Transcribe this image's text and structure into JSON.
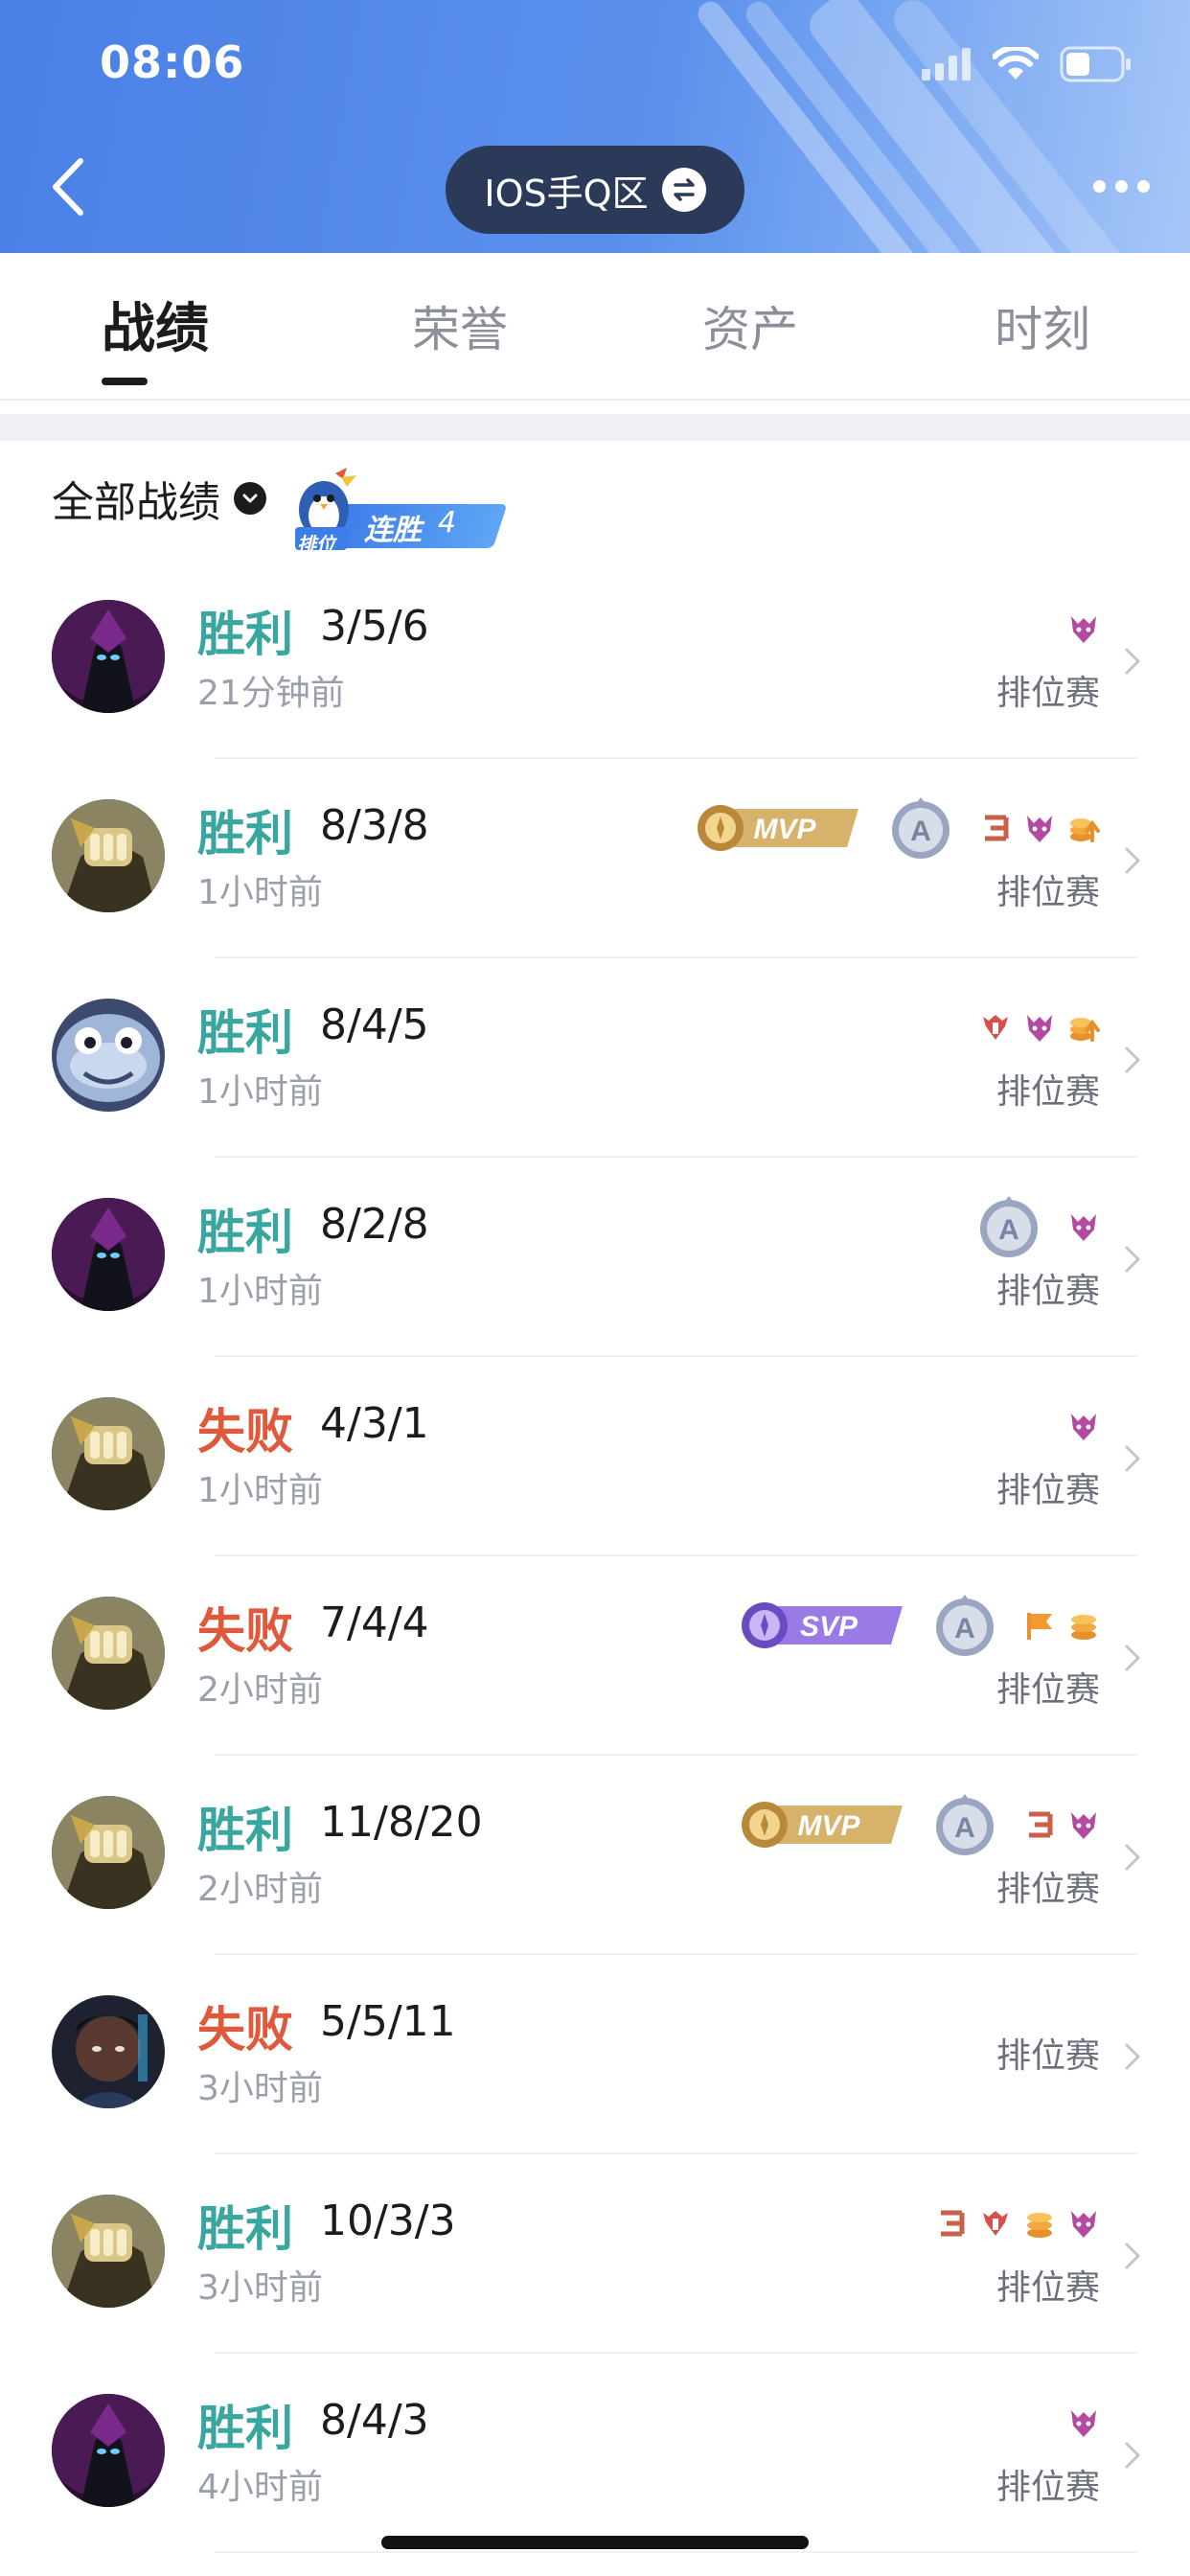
{
  "status_bar": {
    "time": "08:06"
  },
  "header": {
    "region_label": "IOS手Q区"
  },
  "tabs": [
    {
      "label": "战绩",
      "active": true
    },
    {
      "label": "荣誉",
      "active": false
    },
    {
      "label": "资产",
      "active": false
    },
    {
      "label": "时刻",
      "active": false
    }
  ],
  "filter": {
    "label": "全部战绩",
    "streak_prefix": "排位",
    "streak_label": "连胜",
    "streak_count": "4"
  },
  "colors": {
    "win": "#3aa6a0",
    "lose": "#e0593c",
    "header_blue": "#4a7fe6",
    "pill": "#2a3a58"
  },
  "matches": [
    {
      "result": "胜利",
      "outcome": "win",
      "kda": "3/5/6",
      "time": "21分钟前",
      "mode": "排位赛",
      "hero": "dark-assassin",
      "badges": [
        "demon-icon"
      ]
    },
    {
      "result": "胜利",
      "outcome": "win",
      "kda": "8/3/8",
      "time": "1小时前",
      "mode": "排位赛",
      "hero": "gold-mech",
      "badges": [
        "mvp-badge",
        "a-rank-medal",
        "triple-kill-icon",
        "demon-icon",
        "gold-up-icon"
      ]
    },
    {
      "result": "胜利",
      "outcome": "win",
      "kda": "8/4/5",
      "time": "1小时前",
      "mode": "排位赛",
      "hero": "fish-helmet",
      "badges": [
        "tower-icon",
        "demon-icon",
        "gold-up-icon"
      ]
    },
    {
      "result": "胜利",
      "outcome": "win",
      "kda": "8/2/8",
      "time": "1小时前",
      "mode": "排位赛",
      "hero": "dark-assassin",
      "badges": [
        "a-rank-medal",
        "demon-icon"
      ]
    },
    {
      "result": "失败",
      "outcome": "lose",
      "kda": "4/3/1",
      "time": "1小时前",
      "mode": "排位赛",
      "hero": "gold-mech",
      "badges": [
        "demon-icon"
      ]
    },
    {
      "result": "失败",
      "outcome": "lose",
      "kda": "7/4/4",
      "time": "2小时前",
      "mode": "排位赛",
      "hero": "gold-mech",
      "badges": [
        "svp-badge",
        "a-rank-medal",
        "flag-icon",
        "coins-icon"
      ]
    },
    {
      "result": "胜利",
      "outcome": "win",
      "kda": "11/8/20",
      "time": "2小时前",
      "mode": "排位赛",
      "hero": "gold-mech",
      "badges": [
        "mvp-badge",
        "a-rank-medal",
        "triple-kill-icon",
        "demon-icon"
      ]
    },
    {
      "result": "失败",
      "outcome": "lose",
      "kda": "5/5/11",
      "time": "3小时前",
      "mode": "排位赛",
      "hero": "dark-hero",
      "badges": []
    },
    {
      "result": "胜利",
      "outcome": "win",
      "kda": "10/3/3",
      "time": "3小时前",
      "mode": "排位赛",
      "hero": "gold-mech",
      "badges": [
        "triple-kill-icon",
        "tower-icon",
        "coins-icon",
        "demon-icon"
      ]
    },
    {
      "result": "胜利",
      "outcome": "win",
      "kda": "8/4/3",
      "time": "4小时前",
      "mode": "排位赛",
      "hero": "dark-assassin",
      "badges": [
        "demon-icon"
      ]
    }
  ]
}
